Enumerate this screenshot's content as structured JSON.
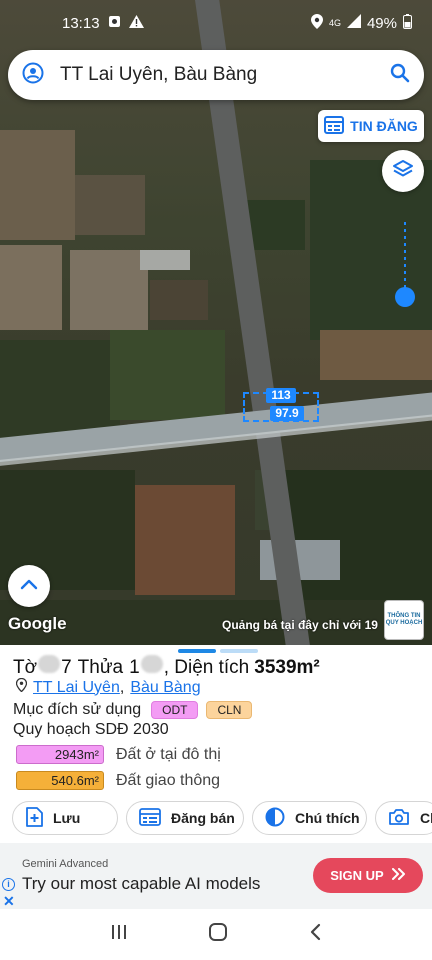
{
  "status_bar": {
    "time": "13:13",
    "network": "4G",
    "battery": "49%"
  },
  "search": {
    "text": "TT Lai Uyên, Bàu Bàng"
  },
  "map": {
    "tin_dang_label": "TIN ĐĂNG",
    "parcel_number": "113",
    "parcel_area": "97.9",
    "google_label": "Google",
    "ad_text": "Quảng bá tại đây chỉ với 19",
    "badge_line1": "THÔNG TIN",
    "badge_line2": "QUY HOẠCH",
    "opacity_level": 0.0
  },
  "parcel": {
    "to_label": "Tờ",
    "to_visible": "7",
    "thua_label": "Thửa",
    "thua_visible": "1",
    "area_label": ", Diện tích",
    "area_value": "3539m²",
    "ward_link": "TT Lai Uyên",
    "separator": ",",
    "district_link": "Bàu Bàng",
    "purpose_label": "Mục đích sử dụng",
    "purpose_tags": [
      "ODT",
      "CLN"
    ],
    "plan_title": "Quy hoạch SDĐ 2030",
    "plan_rows": [
      {
        "value": "2943m²",
        "label": "Đất ở tại đô thị",
        "color": "#f39cf4"
      },
      {
        "value": "540.6m²",
        "label": "Đất giao thông",
        "color": "#f5b039"
      }
    ]
  },
  "actions": [
    {
      "label": "Lưu",
      "icon": "add-document-icon"
    },
    {
      "label": "Đăng bán",
      "icon": "listing-icon"
    },
    {
      "label": "Chú thích",
      "icon": "legend-icon"
    },
    {
      "label": "Chụ",
      "icon": "camera-icon"
    }
  ],
  "ad": {
    "subtitle": "Gemini Advanced",
    "title": "Try our most capable AI models",
    "button": "SIGN UP"
  },
  "colors": {
    "accent": "#1a73e8",
    "signup": "#e5485c",
    "parcel_outline": "#1e88ff"
  }
}
